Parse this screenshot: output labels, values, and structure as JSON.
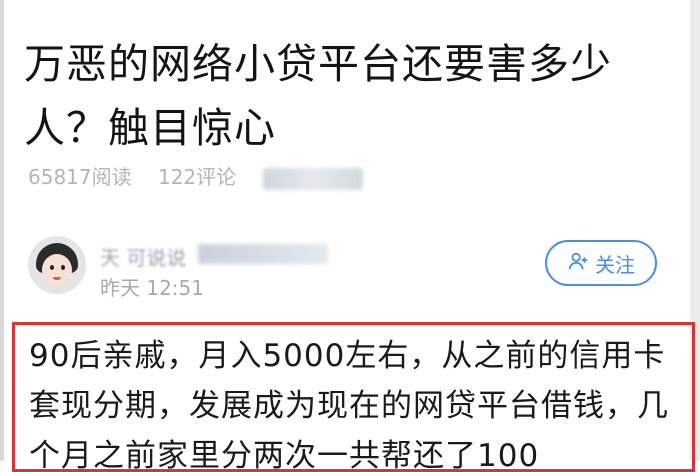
{
  "article": {
    "title": "万恶的网络小贷平台还要害多少人？触目惊心",
    "reads": "65817阅读",
    "comments": "122评论"
  },
  "author": {
    "name": "天 可说说",
    "time": "昨天 12:51",
    "follow_label": "关注"
  },
  "content": {
    "text": "90后亲戚，月入5000左右，从之前的信用卡套现分期，发展成为现在的网贷平台借钱，几个月之前家里分两次一共帮还了100"
  },
  "colors": {
    "accent": "#4a8ee8",
    "highlight_border": "#d93333"
  },
  "icons": {
    "follow": "add-user-icon"
  }
}
